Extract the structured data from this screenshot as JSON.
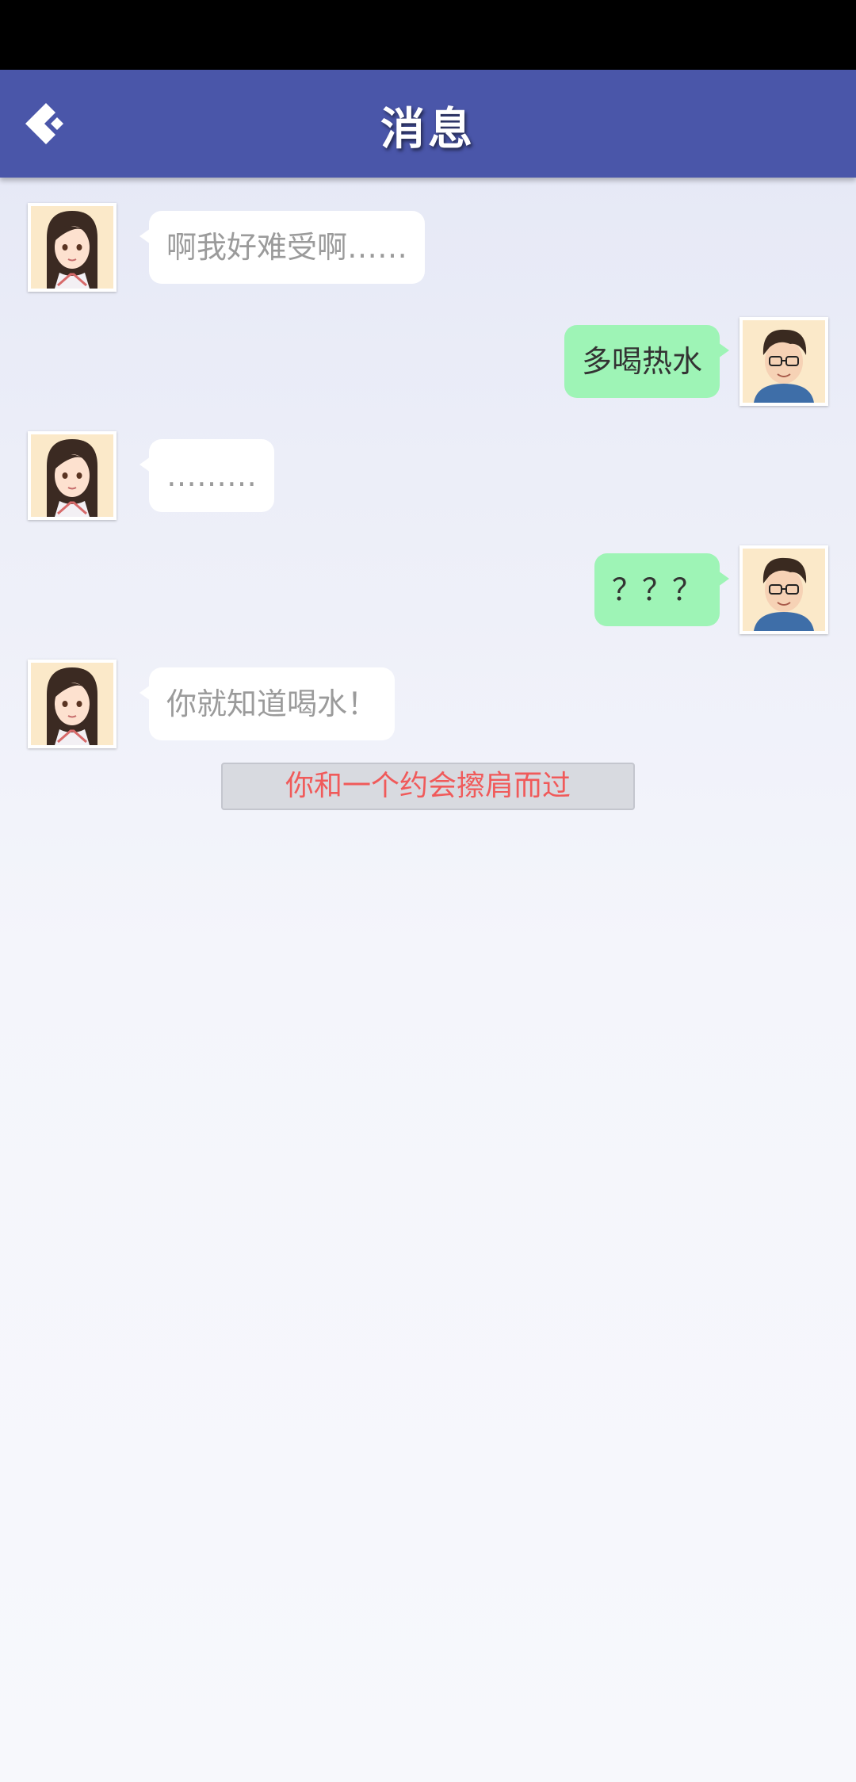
{
  "header": {
    "title": "消息",
    "back_icon": "back-chevron-icon"
  },
  "messages": [
    {
      "side": "left",
      "sender": "girl",
      "text": "啊我好难受啊……"
    },
    {
      "side": "right",
      "sender": "boy",
      "text": "多喝热水"
    },
    {
      "side": "left",
      "sender": "girl",
      "text": "………"
    },
    {
      "side": "right",
      "sender": "boy",
      "text": "？？？"
    },
    {
      "side": "left",
      "sender": "girl",
      "text": "你就知道喝水！"
    }
  ],
  "notice": {
    "text": "你和一个约会擦肩而过",
    "color": "#f05a5a"
  },
  "colors": {
    "header_bg": "#4a56a9",
    "left_bubble": "#ffffff",
    "right_bubble": "#9ef4b6"
  }
}
